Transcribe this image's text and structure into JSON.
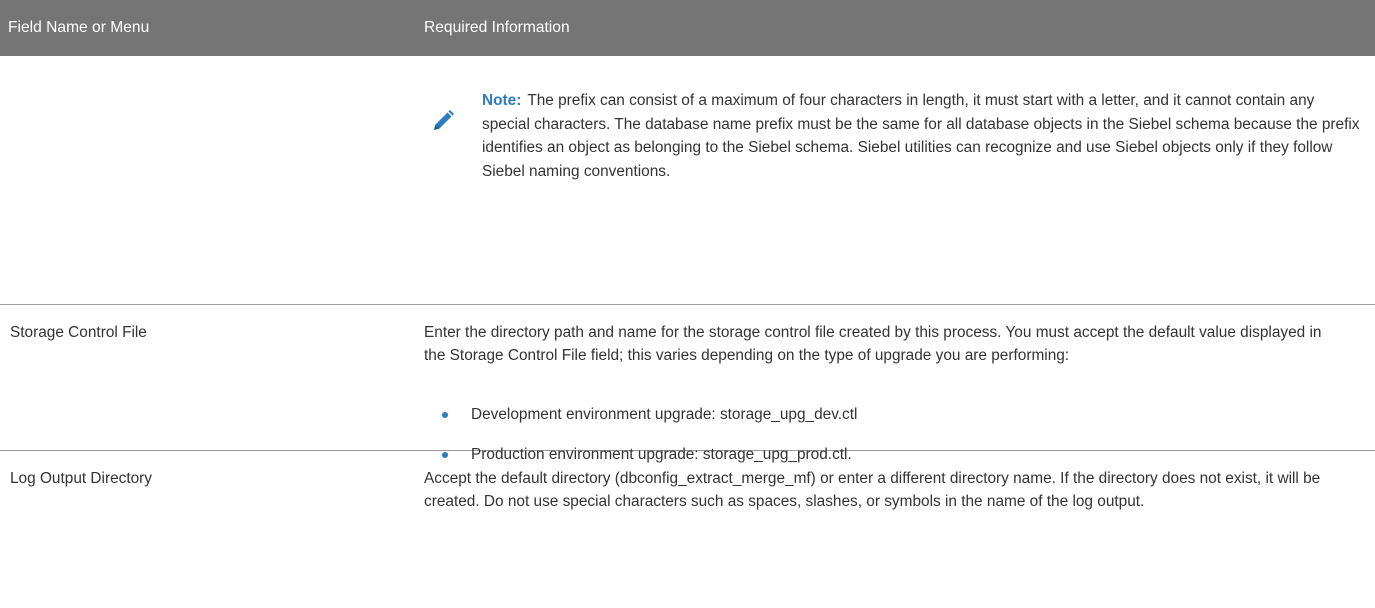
{
  "header": {
    "col1": "Field Name or Menu",
    "col2": "Required Information"
  },
  "rows": [
    {
      "note_label": "Note:",
      "note_text": "The prefix can consist of a maximum of four characters in length, it must start with a letter, and it cannot contain any special characters. The database name prefix must be the same for all database objects in the Siebel schema because the prefix identifies an object as belonging to the Siebel schema. Siebel utilities can recognize and use Siebel objects only if they follow Siebel naming conventions.",
      "note_icon": "pencil-icon",
      "note_color": "#2f7bbf"
    },
    {
      "field": "Storage Control File",
      "info": "Enter the directory path and name for the storage control file created by this process. You must accept the default value displayed in the Storage Control File field; this varies depending on the type of upgrade you are performing:",
      "bullets": [
        "Development environment upgrade: storage_upg_dev.ctl",
        "Production environment upgrade: storage_upg_prod.ctl."
      ]
    },
    {
      "field": "Log Output Directory",
      "info": "Accept the default directory (dbconfig_extract_merge_mf) or enter a different directory name. If the directory does not exist, it will be created. Do not use special characters such as spaces, slashes, or symbols in the name of the log output."
    }
  ],
  "colors": {
    "header_bg": "#757575",
    "accent": "#2f7bbf"
  }
}
